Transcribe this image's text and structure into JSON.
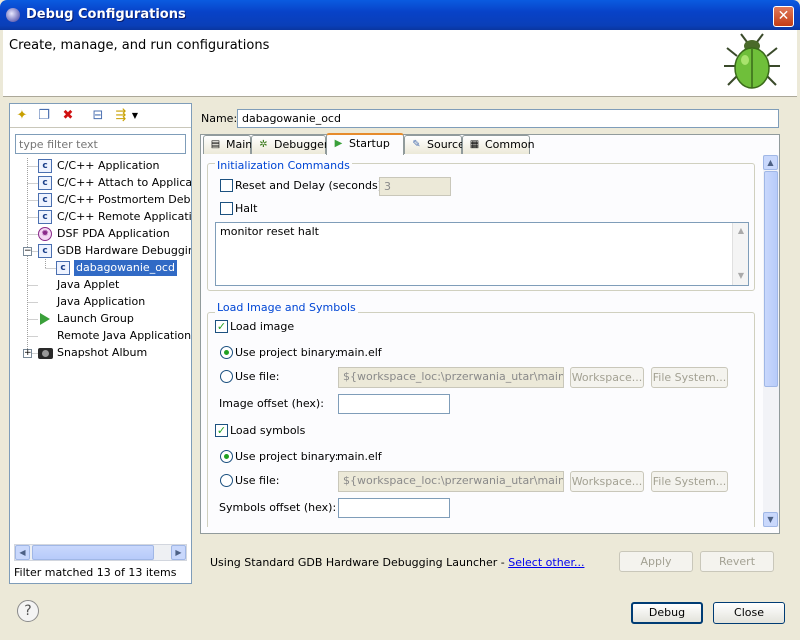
{
  "window": {
    "title": "Debug Configurations",
    "close_glyph": "✕"
  },
  "header": {
    "title": "Create, manage, and run configurations"
  },
  "left": {
    "toolbar": [
      "new-configuration-icon",
      "duplicate-icon",
      "delete-icon",
      "collapse-all-icon",
      "filter-icon",
      "dropdown-arrow-icon"
    ],
    "filter_placeholder": "type filter text",
    "tree": [
      {
        "label": "C/C++ Application",
        "icon": "c-icon",
        "level": 0
      },
      {
        "label": "C/C++ Attach to Application",
        "icon": "c-icon",
        "level": 0
      },
      {
        "label": "C/C++ Postmortem Debugger",
        "icon": "c-icon",
        "level": 0
      },
      {
        "label": "C/C++ Remote Application",
        "icon": "c-icon",
        "level": 0
      },
      {
        "label": "DSF PDA Application",
        "icon": "pda-icon",
        "level": 0
      },
      {
        "label": "GDB Hardware Debugging",
        "icon": "c-icon",
        "level": 0,
        "expanded": true
      },
      {
        "label": "dabagowanie_ocd",
        "icon": "c-icon",
        "level": 1,
        "selected": true
      },
      {
        "label": "Java Applet",
        "icon": "blank-icon",
        "level": 0
      },
      {
        "label": "Java Application",
        "icon": "blank-icon",
        "level": 0
      },
      {
        "label": "Launch Group",
        "icon": "launch-icon",
        "level": 0
      },
      {
        "label": "Remote Java Application",
        "icon": "blank-icon",
        "level": 0
      },
      {
        "label": "Snapshot Album",
        "icon": "camera-icon",
        "level": 0,
        "collapsed": true
      }
    ],
    "filter_status": "Filter matched 13 of 13 items"
  },
  "right": {
    "name_label": "Name:",
    "name_value": "dabagowanie_ocd",
    "tabs": [
      {
        "label": "Main",
        "icon": "main-icon"
      },
      {
        "label": "Debugger",
        "icon": "debugger-icon"
      },
      {
        "label": "Startup",
        "icon": "startup-icon",
        "active": true
      },
      {
        "label": "Source",
        "icon": "source-icon"
      },
      {
        "label": "Common",
        "icon": "common-icon"
      }
    ],
    "init": {
      "title": "Initialization Commands",
      "reset_label": "Reset and Delay (seconds):",
      "reset_value": "3",
      "reset_checked": false,
      "halt_label": "Halt",
      "halt_checked": false,
      "commands": "monitor reset halt"
    },
    "load": {
      "title": "Load Image and Symbols",
      "load_image_label": "Load image",
      "load_image_checked": true,
      "image_use_project_label": "Use project binary:",
      "image_project_binary": "main.elf",
      "image_use_file_label": "Use file:",
      "image_file_value": "${workspace_loc:\\przerwania_utar\\main.bin}",
      "image_workspace_btn": "Workspace...",
      "image_filesystem_btn": "File System...",
      "image_offset_label": "Image offset (hex):",
      "image_offset_value": "",
      "load_symbols_label": "Load symbols",
      "load_symbols_checked": true,
      "sym_use_project_label": "Use project binary:",
      "sym_project_binary": "main.elf",
      "sym_use_file_label": "Use file:",
      "sym_file_value": "${workspace_loc:\\przerwania_utar\\main.bin}",
      "sym_workspace_btn": "Workspace...",
      "sym_filesystem_btn": "File System...",
      "sym_offset_label": "Symbols offset (hex):",
      "sym_offset_value": ""
    },
    "launcher_text": "Using Standard GDB Hardware Debugging Launcher - ",
    "select_other": "Select other...",
    "apply_btn": "Apply",
    "revert_btn": "Revert"
  },
  "footer": {
    "help_glyph": "?",
    "debug_btn": "Debug",
    "close_btn": "Close"
  }
}
